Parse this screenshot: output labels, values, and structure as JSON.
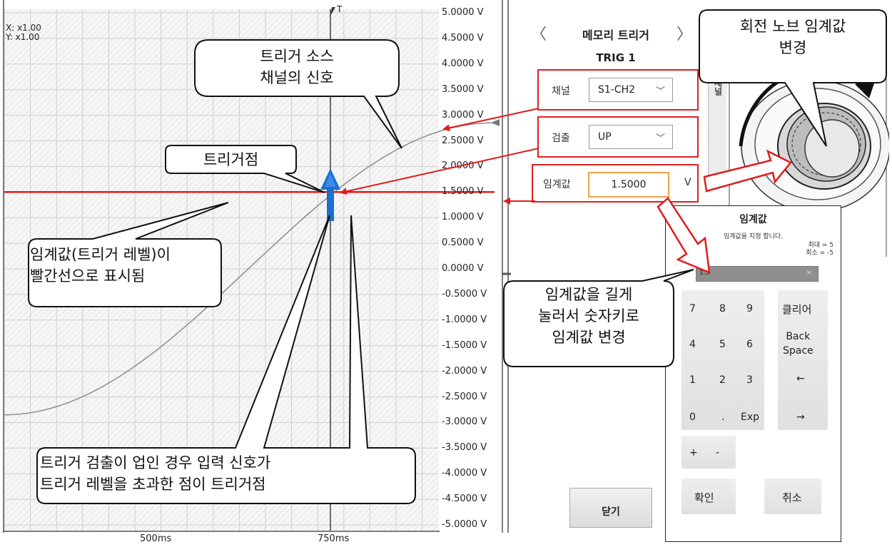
{
  "scope": {
    "scale_x": "X: x1.00",
    "scale_y": "Y: x1.00",
    "trigger_marker": "T",
    "y_ticks": [
      "5.0000 V",
      "4.5000 V",
      "4.0000 V",
      "3.5000 V",
      "3.0000 V",
      "2.5000 V",
      "2.0000 V",
      "1.5000 V",
      "1.0000 V",
      "0.5000 V",
      "0.0000 V",
      "-0.5000 V",
      "-1.0000 V",
      "-1.5000 V",
      "-2.0000 V",
      "-2.5000 V",
      "-3.0000 V",
      "-3.5000 V",
      "-4.0000 V",
      "-4.5000 V",
      "-5.0000 V"
    ],
    "x_ticks": [
      "500ms",
      "750ms"
    ],
    "threshold_level_v": 1.5,
    "colors": {
      "threshold_line": "#e31b1b",
      "trigger_arrow": "#1a6fd0",
      "waveform": "#8c8c8c"
    }
  },
  "panel": {
    "title": "메모리 트리거",
    "subtitle": "TRIG 1",
    "prev_icon": "chevron-left-icon",
    "next_icon": "chevron-right-icon",
    "side_tab": "채널",
    "channel_label": "채널",
    "channel_value": "S1-CH2",
    "detect_label": "검출",
    "detect_value": "UP",
    "threshold_label": "임계값",
    "threshold_value": "1.5000",
    "threshold_unit": "V",
    "close_label": "닫기"
  },
  "dialog": {
    "title": "임계값",
    "description": "임계값을 지정 합니다.",
    "max_text": "최대 = 5",
    "min_text": "최소 = -5",
    "input_value": "1.5",
    "clear_x": "×",
    "keys": {
      "k7": "7",
      "k8": "8",
      "k9": "9",
      "clear": "클리어",
      "k4": "4",
      "k5": "5",
      "k6": "6",
      "backspace_1": "Back",
      "backspace_2": "Space",
      "k1": "1",
      "k2": "2",
      "k3": "3",
      "left": "←",
      "k0": "0",
      "dot": ".",
      "exp": "Exp",
      "right": "→",
      "plus": "+",
      "minus": "-",
      "ok": "확인",
      "cancel": "취소"
    }
  },
  "callouts": {
    "source_signal_1": "트리거 소스",
    "source_signal_2": "채널의 신호",
    "trigger_point": "트리거점",
    "threshold_line_1": "임계값(트리거 레벨)이",
    "threshold_line_2": "빨간선으로 표시됨",
    "detect_up_1": "트리거 검출이 업인 경우 입력 신호가",
    "detect_up_2": "트리거 레벨을 초과한 점이 트리거점",
    "long_press_1": "임계값을 길게",
    "long_press_2": "눌러서 숫자키로",
    "long_press_3": "임계값 변경",
    "knob_1": "회전 노브 임계값",
    "knob_2": "변경"
  }
}
